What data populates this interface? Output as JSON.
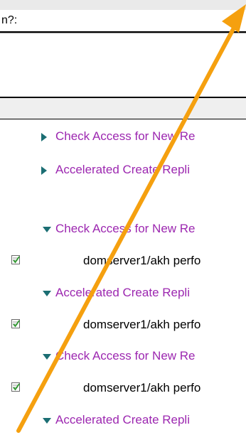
{
  "field": {
    "label": "n?:"
  },
  "rows": [
    {
      "kind": "category",
      "state": "collapsed",
      "text": "Check Access for New Re"
    },
    {
      "kind": "category",
      "state": "collapsed",
      "text": "Accelerated Create Repli"
    },
    {
      "kind": "category",
      "state": "expanded",
      "text": "Check Access for New Re"
    },
    {
      "kind": "document",
      "text": "domserver1/akh perfo"
    },
    {
      "kind": "category",
      "state": "expanded",
      "text": "Accelerated Create Repli"
    },
    {
      "kind": "document",
      "text": "domserver1/akh perfo"
    },
    {
      "kind": "category",
      "state": "expanded",
      "text": "Check Access for New Re"
    },
    {
      "kind": "document",
      "text": "domserver1/akh perfo"
    },
    {
      "kind": "category",
      "state": "expanded",
      "text": "Accelerated Create Repli"
    }
  ],
  "colors": {
    "category_text": "#9c27b0",
    "twisty": "#1b6e73",
    "annotation_arrow": "#f5a00f"
  },
  "icons": {
    "collapsed": "twisty-right-icon",
    "expanded": "twisty-down-icon",
    "document": "document-check-icon"
  }
}
